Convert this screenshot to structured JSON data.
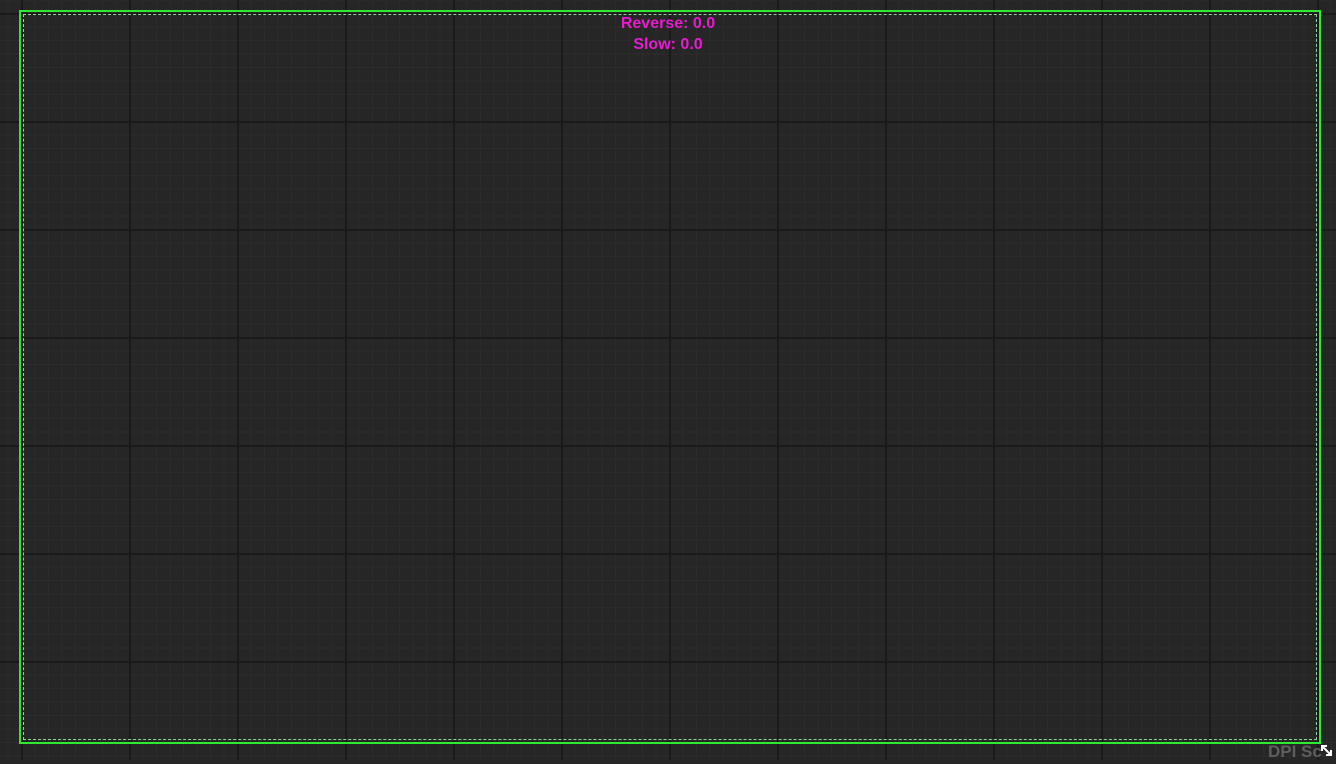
{
  "debug": {
    "reverse_text": "Reverse: 0.0",
    "slow_text": "Slow: 0.0"
  },
  "dpi": {
    "label": "DPI Sc"
  },
  "colors": {
    "background": "#262626",
    "canvas_border": "#2eea2e",
    "debug_text": "#e81bd0",
    "dpi_label": "#5e5e5e"
  },
  "icons": {
    "resize_handle": "resize-diagonal-icon"
  }
}
